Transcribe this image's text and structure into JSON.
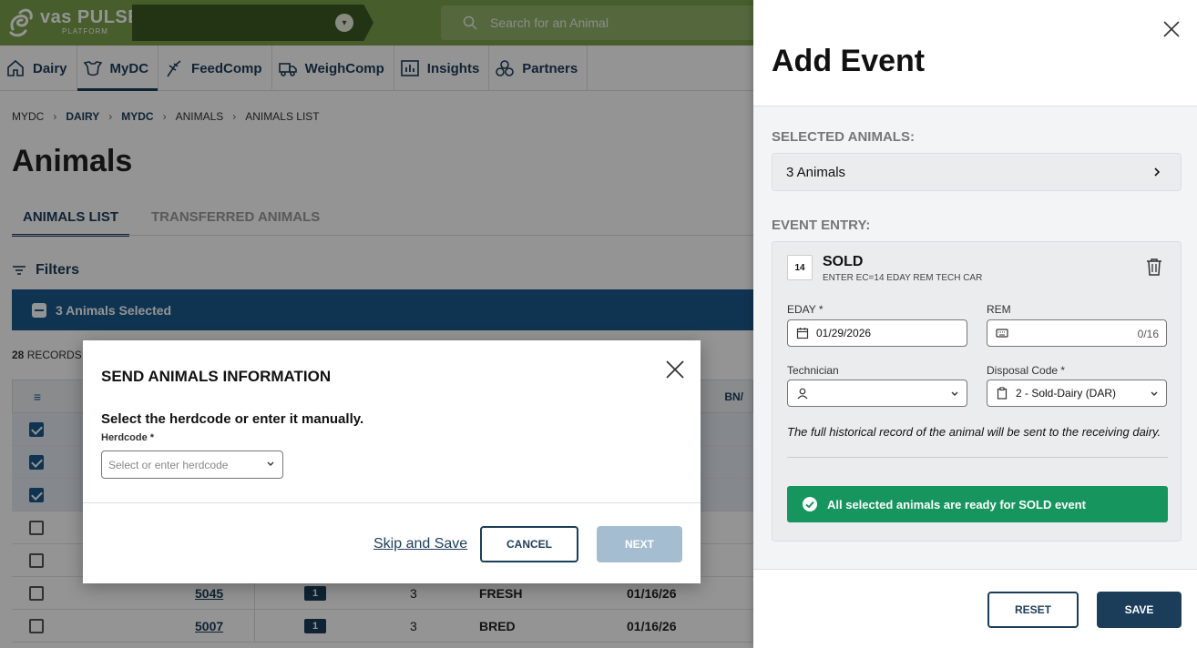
{
  "header": {
    "logo_title": "vas PULSE",
    "logo_sub": "PLATFORM",
    "search_placeholder": "Search for an Animal"
  },
  "nav": {
    "items": [
      {
        "label": "Dairy",
        "icon": "home-icon"
      },
      {
        "label": "MyDC",
        "icon": "cow-icon"
      },
      {
        "label": "FeedComp",
        "icon": "feed-icon"
      },
      {
        "label": "WeighComp",
        "icon": "truck-icon"
      },
      {
        "label": "Insights",
        "icon": "chart-icon"
      },
      {
        "label": "Partners",
        "icon": "partners-icon"
      }
    ]
  },
  "breadcrumb": [
    "MYDC",
    "DAIRY",
    "MYDC",
    "ANIMALS",
    "ANIMALS LIST"
  ],
  "page": {
    "title": "Animals",
    "tabs": [
      "ANIMALS LIST",
      "TRANSFERRED ANIMALS"
    ],
    "filters_label": "Filters",
    "selected_text": "3 Animals Selected",
    "records_count": "28",
    "records_label": "RECORDS",
    "table_header_partial": "BN/"
  },
  "table": {
    "rows": [
      {
        "checked": true,
        "id": "",
        "lact_badge": "",
        "lact": "",
        "status": "",
        "date": ""
      },
      {
        "checked": true,
        "id": "",
        "lact_badge": "",
        "lact": "",
        "status": "",
        "date": ""
      },
      {
        "checked": true,
        "id": "",
        "lact_badge": "",
        "lact": "",
        "status": "",
        "date": ""
      },
      {
        "checked": false,
        "id": "",
        "lact_badge": "",
        "lact": "",
        "status": "",
        "date": ""
      },
      {
        "checked": false,
        "id": "",
        "lact_badge": "",
        "lact": "",
        "status": "",
        "date": ""
      },
      {
        "checked": false,
        "id": "5045",
        "lact_badge": "1",
        "lact": "3",
        "status": "FRESH",
        "date": "01/16/26"
      },
      {
        "checked": false,
        "id": "5007",
        "lact_badge": "1",
        "lact": "3",
        "status": "BRED",
        "date": "01/16/26"
      }
    ]
  },
  "modal": {
    "title": "SEND ANIMALS INFORMATION",
    "subtitle": "Select the herdcode or enter it manually.",
    "herdcode_label": "Herdcode *",
    "herdcode_placeholder": "Select or enter herdcode",
    "skip_label": "Skip and Save",
    "cancel_label": "CANCEL",
    "next_label": "NEXT"
  },
  "panel": {
    "title": "Add Event",
    "selected_label": "SELECTED ANIMALS:",
    "selected_value": "3 Animals",
    "event_entry_label": "EVENT ENTRY:",
    "event": {
      "code": "14",
      "name": "SOLD",
      "desc": "ENTER EC=14 EDAY REM TECH CAR",
      "eday_label": "EDAY *",
      "eday_value": "01/29/2026",
      "rem_label": "REM",
      "rem_count": "0/16",
      "tech_label": "Technician",
      "tech_value": "",
      "disposal_label": "Disposal Code *",
      "disposal_value": "2 - Sold-Dairy (DAR)",
      "note": "The full historical record of the animal will be sent to the receiving dairy.",
      "ready_text": "All selected animals are ready for SOLD event"
    },
    "reset_label": "RESET",
    "save_label": "SAVE"
  },
  "colors": {
    "brand_green": "#7aa04a",
    "navy": "#1c3d5a",
    "selected_blue": "#1a5a8e",
    "success_green": "#17955f",
    "disabled_blue": "#a4bdd0"
  }
}
